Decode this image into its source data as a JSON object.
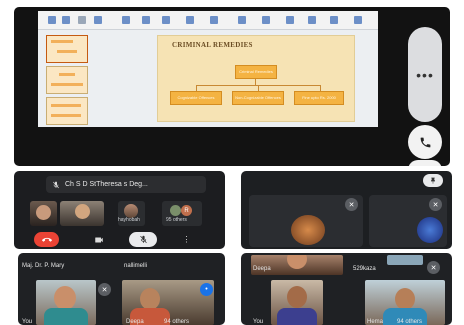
{
  "presentation": {
    "slide_title": "CRIMINAL REMEDIES",
    "root_node": "Criminal Remedies",
    "child_nodes": [
      "Cognizable Offences",
      "Non-Cognizable Offences",
      "Fine upto Rs. 2000"
    ]
  },
  "call": {
    "meeting_label": "Ch S D StTheresa s Deg...",
    "participants": {
      "tile_3": "hayhobah",
      "others_count": "95 others"
    }
  },
  "grid": {
    "left_top_names": [
      "Maj. Dr. P. Mary",
      "nallimelli"
    ],
    "left_bottom_labels": [
      "You",
      "Deepa",
      "94 others"
    ],
    "right_top_names": [
      "Deepa",
      "529kaza"
    ],
    "right_bottom_labels": [
      "You",
      "Hema",
      "94 others"
    ]
  },
  "colors": {
    "end_call": "#ea4335",
    "meet_bg": "#1f2124",
    "slide_bg": "#f6e3b4",
    "node_orange": "#f4b342"
  },
  "icons": {
    "more": "more-vert-icon",
    "phone": "phone-icon",
    "pin": "pin-icon",
    "mic_off": "mic-off-icon",
    "video": "video-icon"
  }
}
